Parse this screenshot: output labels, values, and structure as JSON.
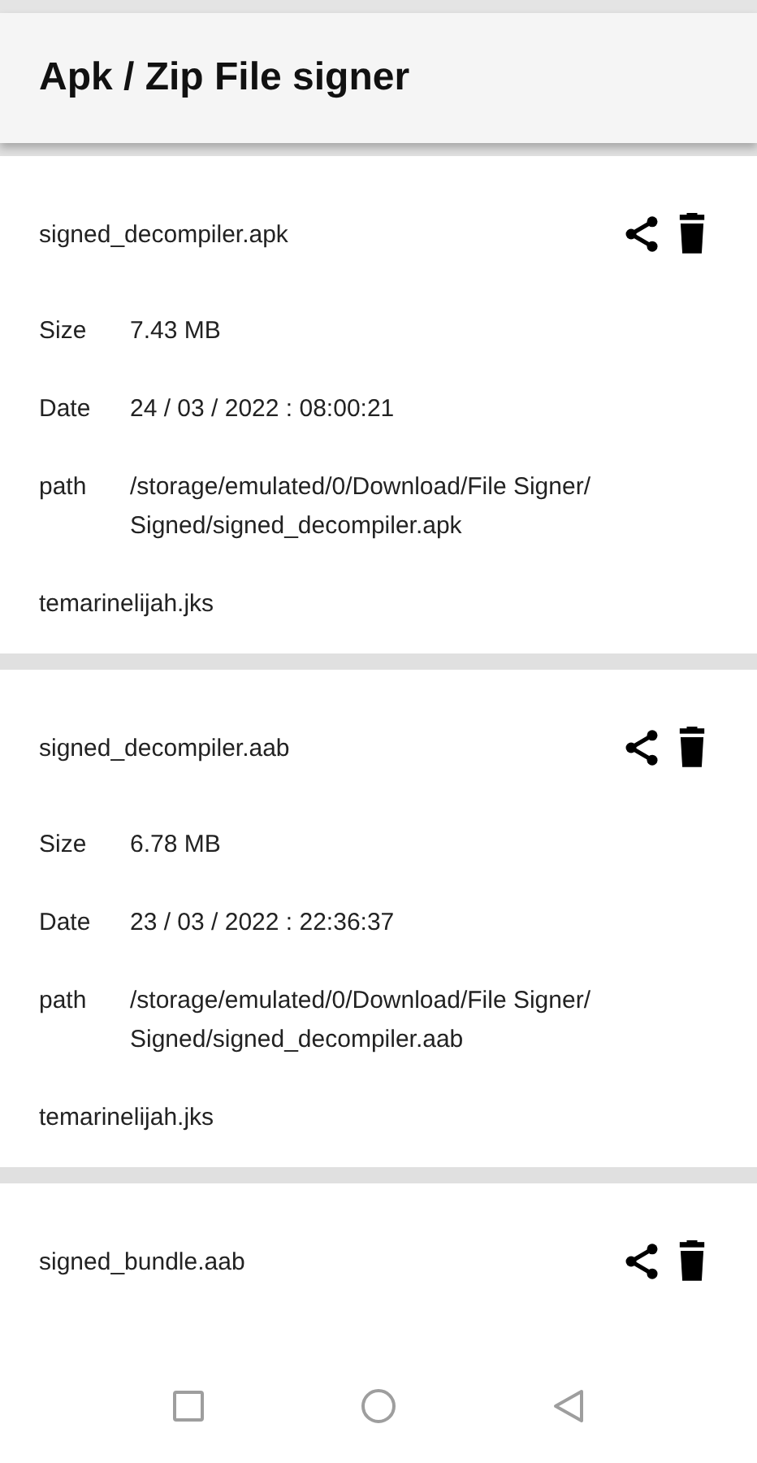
{
  "app_bar": {
    "title": "Apk / Zip File signer"
  },
  "files": [
    {
      "name": "signed_decompiler.apk",
      "details": [
        {
          "label": "Size",
          "value": "7.43 MB"
        },
        {
          "label": "Date",
          "value": "24 / 03 / 2022 : 08:00:21"
        },
        {
          "label": "path",
          "value": "/storage/emulated/0/Download/File Signer/ Signed/signed_decompiler.apk"
        }
      ],
      "keystore": "temarinelijah.jks"
    },
    {
      "name": "signed_decompiler.aab",
      "details": [
        {
          "label": "Size",
          "value": "6.78 MB"
        },
        {
          "label": "Date",
          "value": "23 / 03 / 2022 : 22:36:37"
        },
        {
          "label": "path",
          "value": "/storage/emulated/0/Download/File Signer/ Signed/signed_decompiler.aab"
        }
      ],
      "keystore": "temarinelijah.jks"
    },
    {
      "name": "signed_bundle.aab"
    }
  ]
}
